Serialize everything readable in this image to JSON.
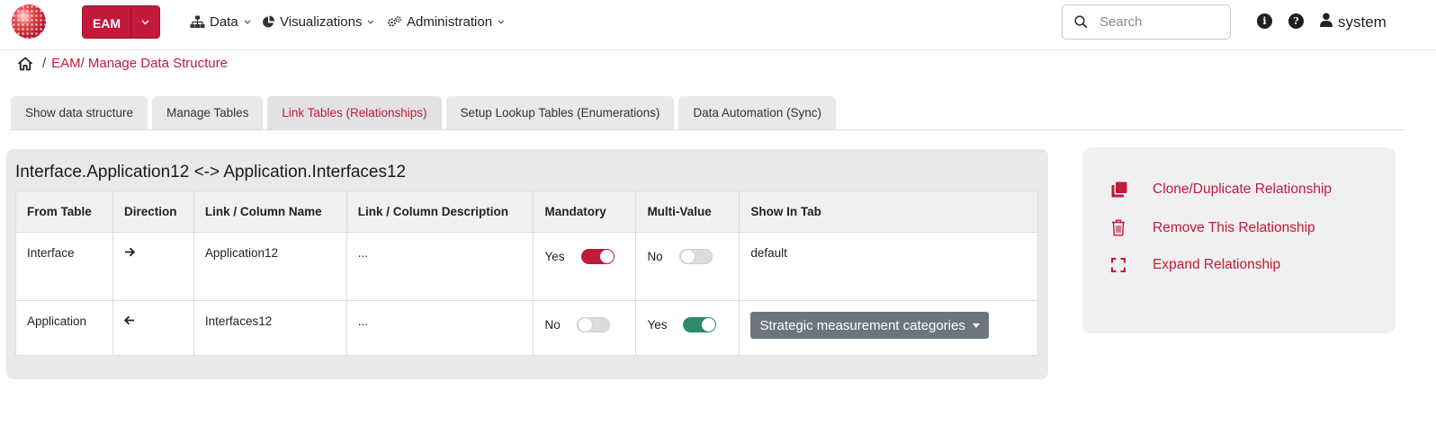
{
  "colors": {
    "accent": "#c3193a",
    "toggle_on_red": "#c3193a",
    "toggle_on_green": "#2e8b6a",
    "select_bg": "#6c757d"
  },
  "navbar": {
    "logo_icon": "globe-logo",
    "app_button_label": "EAM",
    "menus": [
      {
        "label": "Data",
        "icon": "sitemap-icon"
      },
      {
        "label": "Visualizations",
        "icon": "pie-chart-icon"
      },
      {
        "label": "Administration",
        "icon": "gears-icon"
      }
    ],
    "search_placeholder": "Search",
    "info_icon": "info-icon",
    "help_icon": "help-icon",
    "user_label": "system"
  },
  "breadcrumb": {
    "home_icon": "home-icon",
    "sep": "/",
    "items": [
      "EAM/",
      "Manage Data Structure"
    ]
  },
  "tabs": [
    {
      "label": "Show data structure",
      "active": false
    },
    {
      "label": "Manage Tables",
      "active": false
    },
    {
      "label": "Link Tables (Relationships)",
      "active": true
    },
    {
      "label": "Setup Lookup Tables (Enumerations)",
      "active": false
    },
    {
      "label": "Data Automation (Sync)",
      "active": false
    }
  ],
  "relationship": {
    "title": "Interface.Application12 <-> Application.Interfaces12",
    "columns": [
      "From Table",
      "Direction",
      "Link / Column Name",
      "Link / Column Description",
      "Mandatory",
      "Multi-Value",
      "Show In Tab"
    ],
    "rows": [
      {
        "from_table": "Interface",
        "direction": "right-arrow-icon",
        "column_name": "Application12",
        "description": "...",
        "mandatory_label": "Yes",
        "mandatory": true,
        "multi_label": "No",
        "multi": false,
        "show_in_tab": "default"
      },
      {
        "from_table": "Application",
        "direction": "left-arrow-icon",
        "column_name": "Interfaces12",
        "description": "...",
        "mandatory_label": "No",
        "mandatory": false,
        "multi_label": "Yes",
        "multi": true,
        "show_in_tab": "Strategic measurement categories"
      }
    ]
  },
  "actions": [
    {
      "label": "Clone/Duplicate Relationship",
      "icon": "clone-icon"
    },
    {
      "label": "Remove This Relationship",
      "icon": "trash-icon"
    },
    {
      "label": "Expand Relationship",
      "icon": "expand-icon"
    }
  ]
}
